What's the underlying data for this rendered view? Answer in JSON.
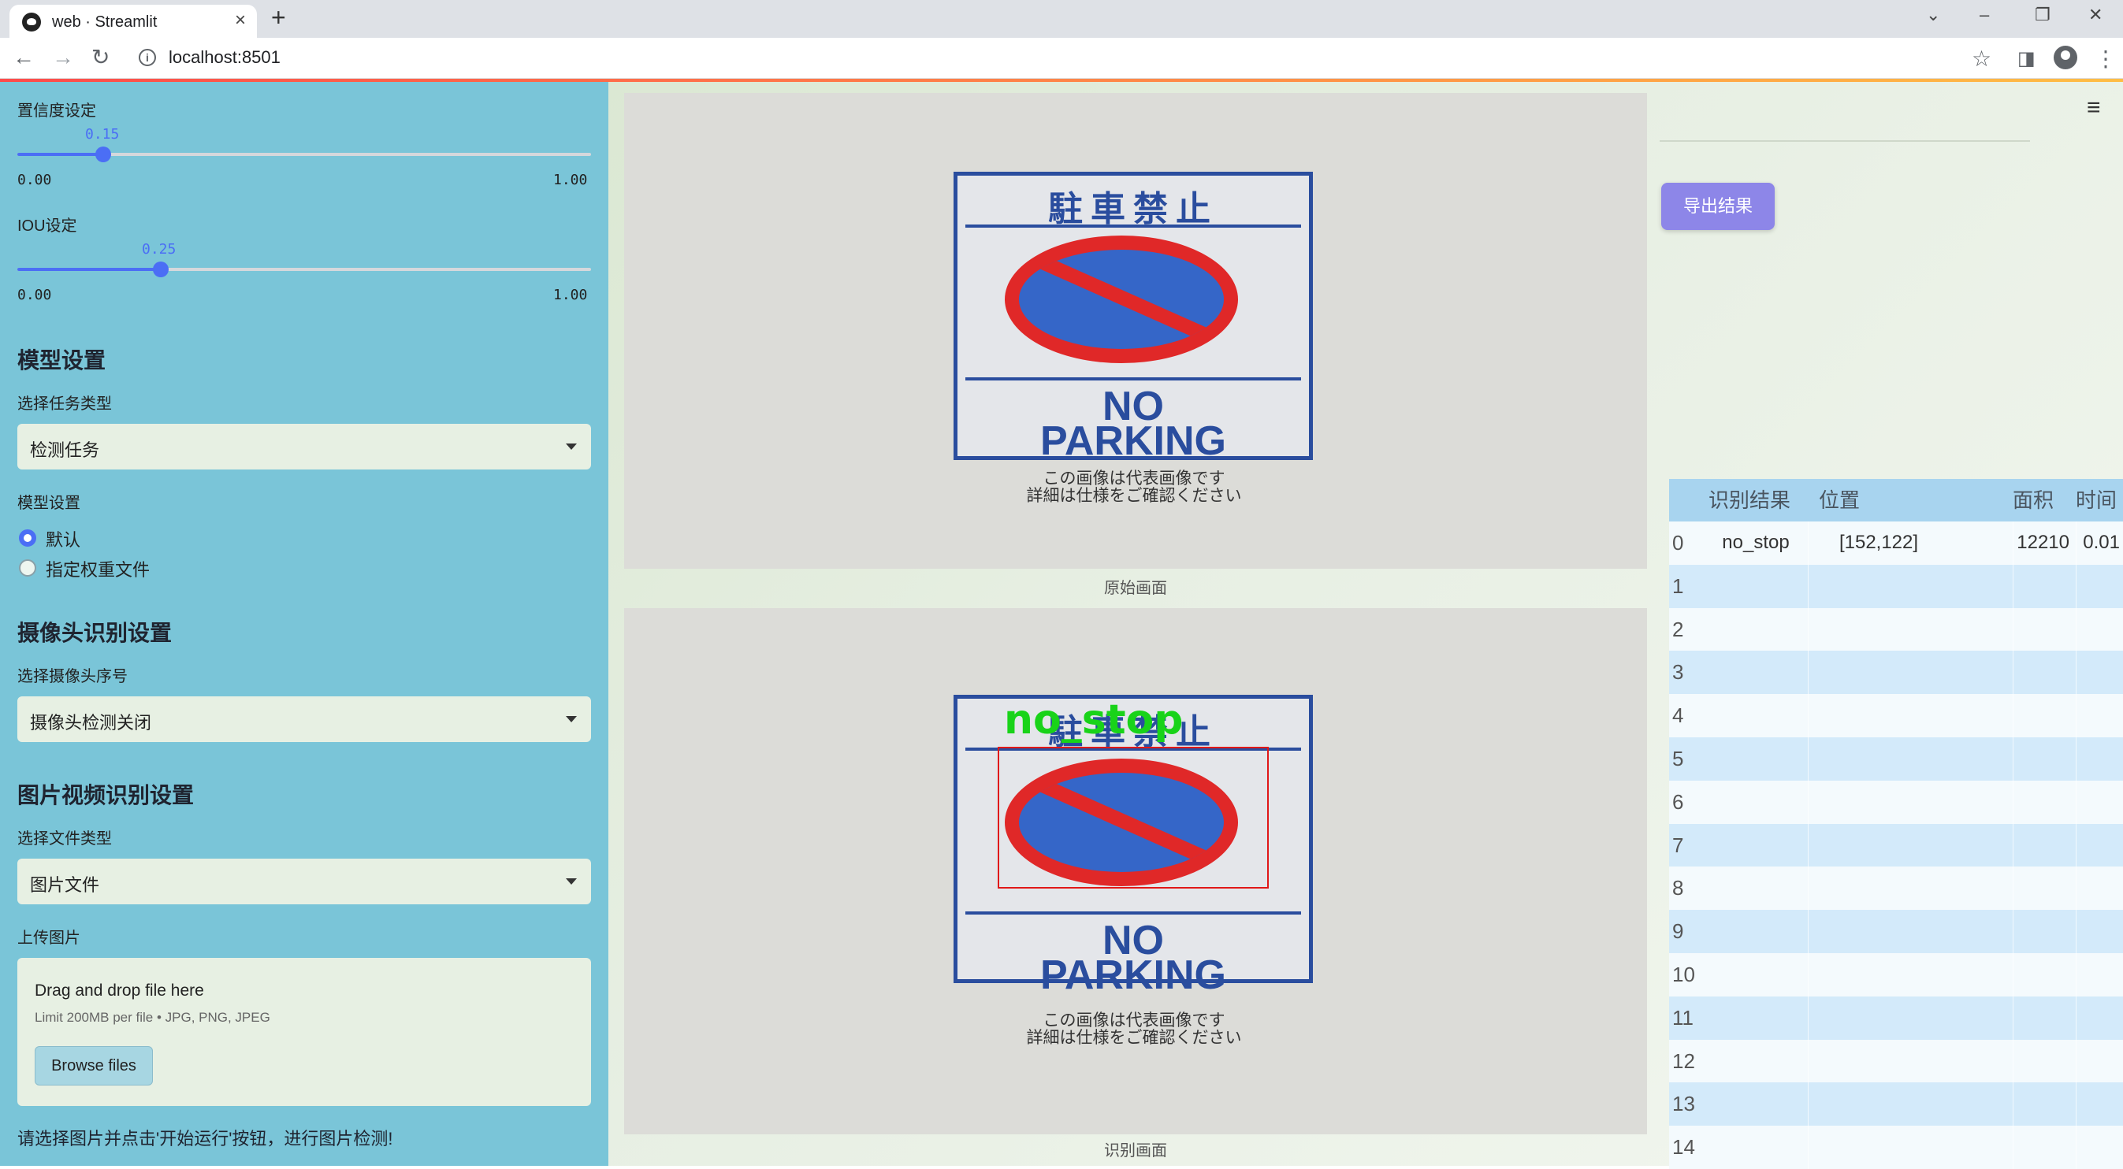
{
  "browser": {
    "tab_title": "web · Streamlit",
    "url": "localhost:8501"
  },
  "sidebar": {
    "confidence": {
      "label": "置信度设定",
      "value_text": "0.15",
      "value": 0.15,
      "min": "0.00",
      "max": "1.00"
    },
    "iou": {
      "label": "IOU设定",
      "value_text": "0.25",
      "value": 0.25,
      "min": "0.00",
      "max": "1.00"
    },
    "model_section": "模型设置",
    "task_label": "选择任务类型",
    "task_value": "检测任务",
    "model_label": "模型设置",
    "model_options": [
      "默认",
      "指定权重文件"
    ],
    "model_selected": 0,
    "camera_section": "摄像头识别设置",
    "camera_label": "选择摄像头序号",
    "camera_value": "摄像头检测关闭",
    "media_section": "图片视频识别设置",
    "filetype_label": "选择文件类型",
    "filetype_value": "图片文件",
    "upload_label": "上传图片",
    "upload_title": "Drag and drop file here",
    "upload_limit": "Limit 200MB per file • JPG, PNG, JPEG",
    "browse_label": "Browse files",
    "status": "请选择图片并点击'开始运行'按钮，进行图片检测!"
  },
  "main": {
    "original_caption": "原始画面",
    "result_caption": "识别画面",
    "sign_jp": "駐車禁止",
    "sign_no": "NO",
    "sign_parking": "PARKING",
    "sign_small_1": "この画像は代表画像です",
    "sign_small_2": "詳細は仕様をご確認ください",
    "detection_label": "no_stop",
    "export_label": "导出结果",
    "table": {
      "headers": [
        "识别结果",
        "位置",
        "面积",
        "时间"
      ],
      "rows": [
        {
          "idx": "0",
          "result": "no_stop",
          "position": "[152,122]",
          "area": "12210",
          "time": "0.01"
        },
        {
          "idx": "1"
        },
        {
          "idx": "2"
        },
        {
          "idx": "3"
        },
        {
          "idx": "4"
        },
        {
          "idx": "5"
        },
        {
          "idx": "6"
        },
        {
          "idx": "7"
        },
        {
          "idx": "8"
        },
        {
          "idx": "9"
        },
        {
          "idx": "10"
        },
        {
          "idx": "11"
        },
        {
          "idx": "12"
        },
        {
          "idx": "13"
        },
        {
          "idx": "14"
        }
      ]
    }
  },
  "colors": {
    "sidebar_bg": "#7ac5d8",
    "accent": "#4b6ef5",
    "export_button": "#8d86e8",
    "table_header": "#a8d4ef",
    "row_alt": "#d3eafa",
    "detection_box": "#e01818",
    "detection_text": "#19d319"
  }
}
